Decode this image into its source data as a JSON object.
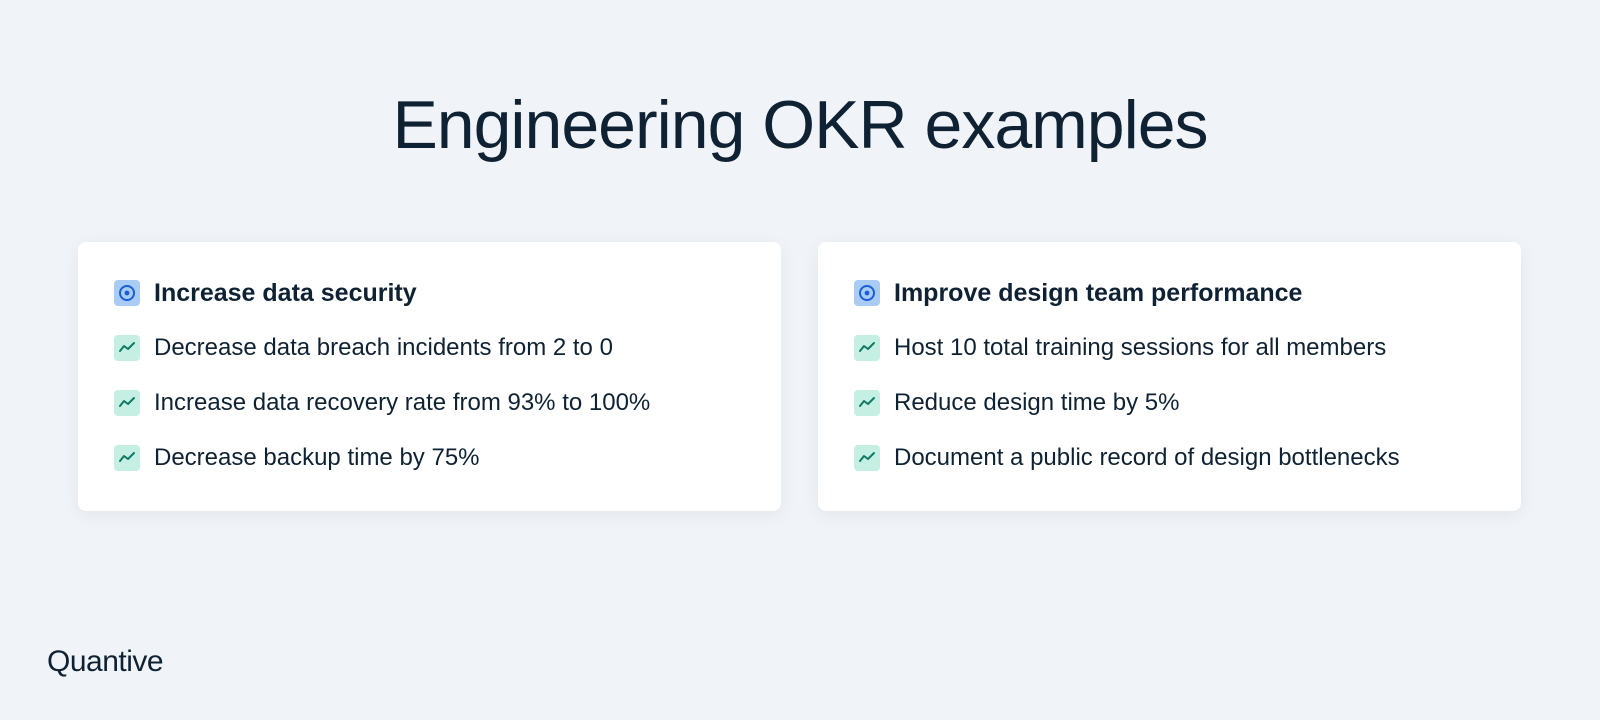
{
  "page": {
    "title": "Engineering OKR examples"
  },
  "cards": [
    {
      "objective": "Increase data security",
      "key_results": [
        "Decrease data breach incidents from 2 to 0",
        "Increase data recovery rate from 93% to 100%",
        "Decrease backup time by 75%"
      ]
    },
    {
      "objective": "Improve design team performance",
      "key_results": [
        "Host 10 total training sessions for all members",
        "Reduce design time by 5%",
        "Document a public record of design bottlenecks"
      ]
    }
  ],
  "brand": {
    "logo_text": "Quantive"
  },
  "icons": {
    "objective": "target-icon",
    "key_result": "trend-line-icon"
  },
  "colors": {
    "background": "#f0f3f7",
    "text": "#0f2233",
    "objective_icon_bg": "#a9ccf7",
    "objective_icon_fg": "#1a5fd6",
    "key_result_icon_bg": "#c6efe4",
    "key_result_icon_fg": "#0f7a63"
  }
}
